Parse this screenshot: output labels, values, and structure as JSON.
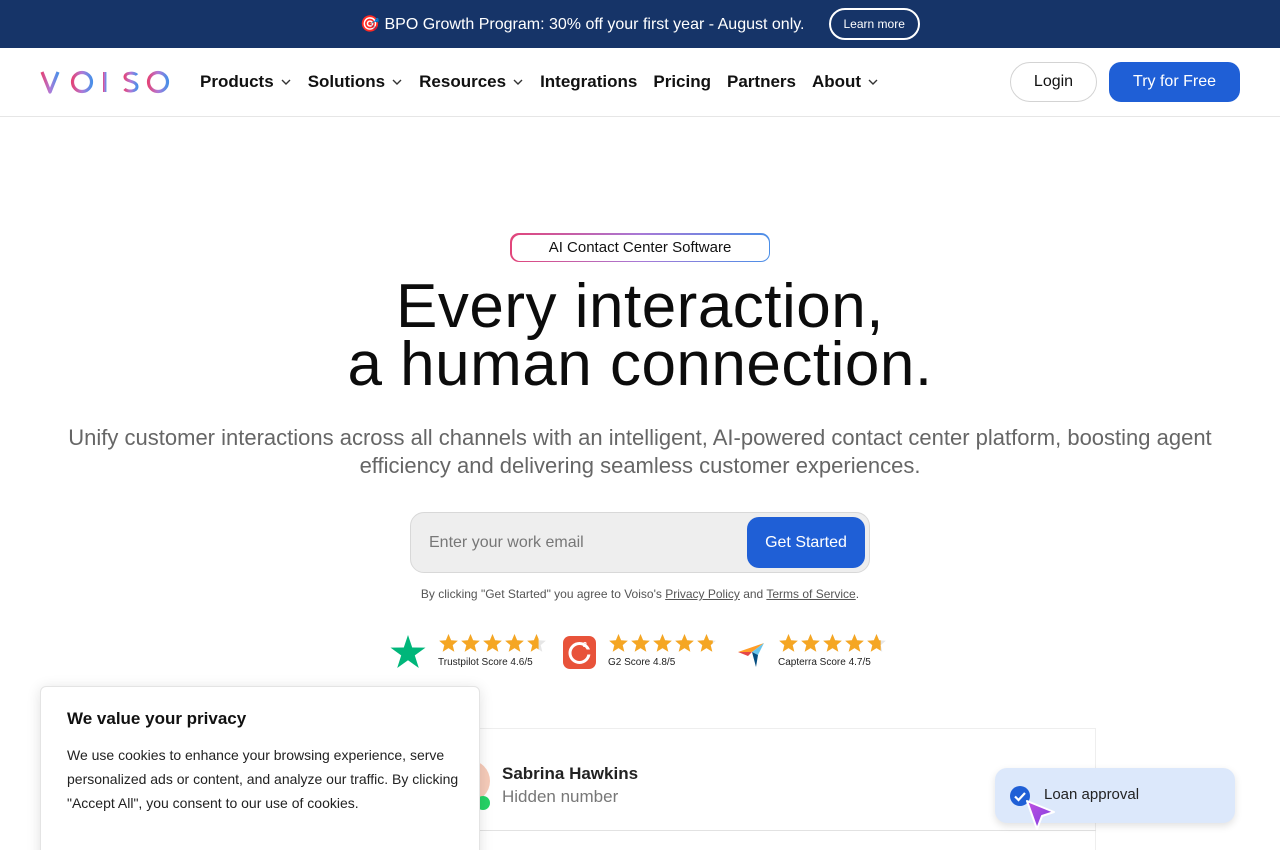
{
  "banner": {
    "text": "🎯 BPO Growth Program: 30% off your first year - August only.",
    "button_label": "Learn more"
  },
  "nav": {
    "logo_text": "VOISO",
    "items": [
      {
        "label": "Products",
        "has_dropdown": true
      },
      {
        "label": "Solutions",
        "has_dropdown": true
      },
      {
        "label": "Resources",
        "has_dropdown": true
      },
      {
        "label": "Integrations",
        "has_dropdown": false
      },
      {
        "label": "Pricing",
        "has_dropdown": false
      },
      {
        "label": "Partners",
        "has_dropdown": false
      },
      {
        "label": "About",
        "has_dropdown": true
      }
    ],
    "login_label": "Login",
    "try_label": "Try for Free"
  },
  "hero": {
    "tag": "AI Contact Center Software",
    "headline_line1": "Every interaction,",
    "headline_line2": "a human connection.",
    "subtext": "Unify customer interactions across all channels with an intelligent, AI-powered contact center platform, boosting agent efficiency and delivering seamless customer experiences.",
    "email_placeholder": "Enter your work email",
    "cta_label": "Get Started",
    "legal_prefix": "By clicking \"Get Started\" you agree to Voiso's ",
    "privacy_link": "Privacy Policy",
    "legal_and": " and ",
    "terms_link": "Terms of Service",
    "legal_suffix": "."
  },
  "ratings": [
    {
      "icon": "trustpilot-icon",
      "label": "Trustpilot Score 4.6/5",
      "score": 4.6
    },
    {
      "icon": "g2-icon",
      "label": "G2 Score 4.8/5",
      "score": 4.8
    },
    {
      "icon": "capterra-icon",
      "label": "Capterra Score 4.7/5",
      "score": 4.7
    }
  ],
  "preview": {
    "contact_name": "Sabrina Hawkins",
    "contact_sub": "Hidden number",
    "loan_label": "Loan approval"
  },
  "cookie": {
    "title": "We value your privacy",
    "text": "We use cookies to enhance your browsing experience, serve personalized ads or content, and analyze our traffic. By clicking \"Accept All\", you consent to our use of cookies."
  },
  "colors": {
    "banner_bg": "#163468",
    "primary": "#1f5fd6",
    "star": "#f5a623",
    "trustpilot": "#00b67a",
    "g2": "#e8533a"
  }
}
